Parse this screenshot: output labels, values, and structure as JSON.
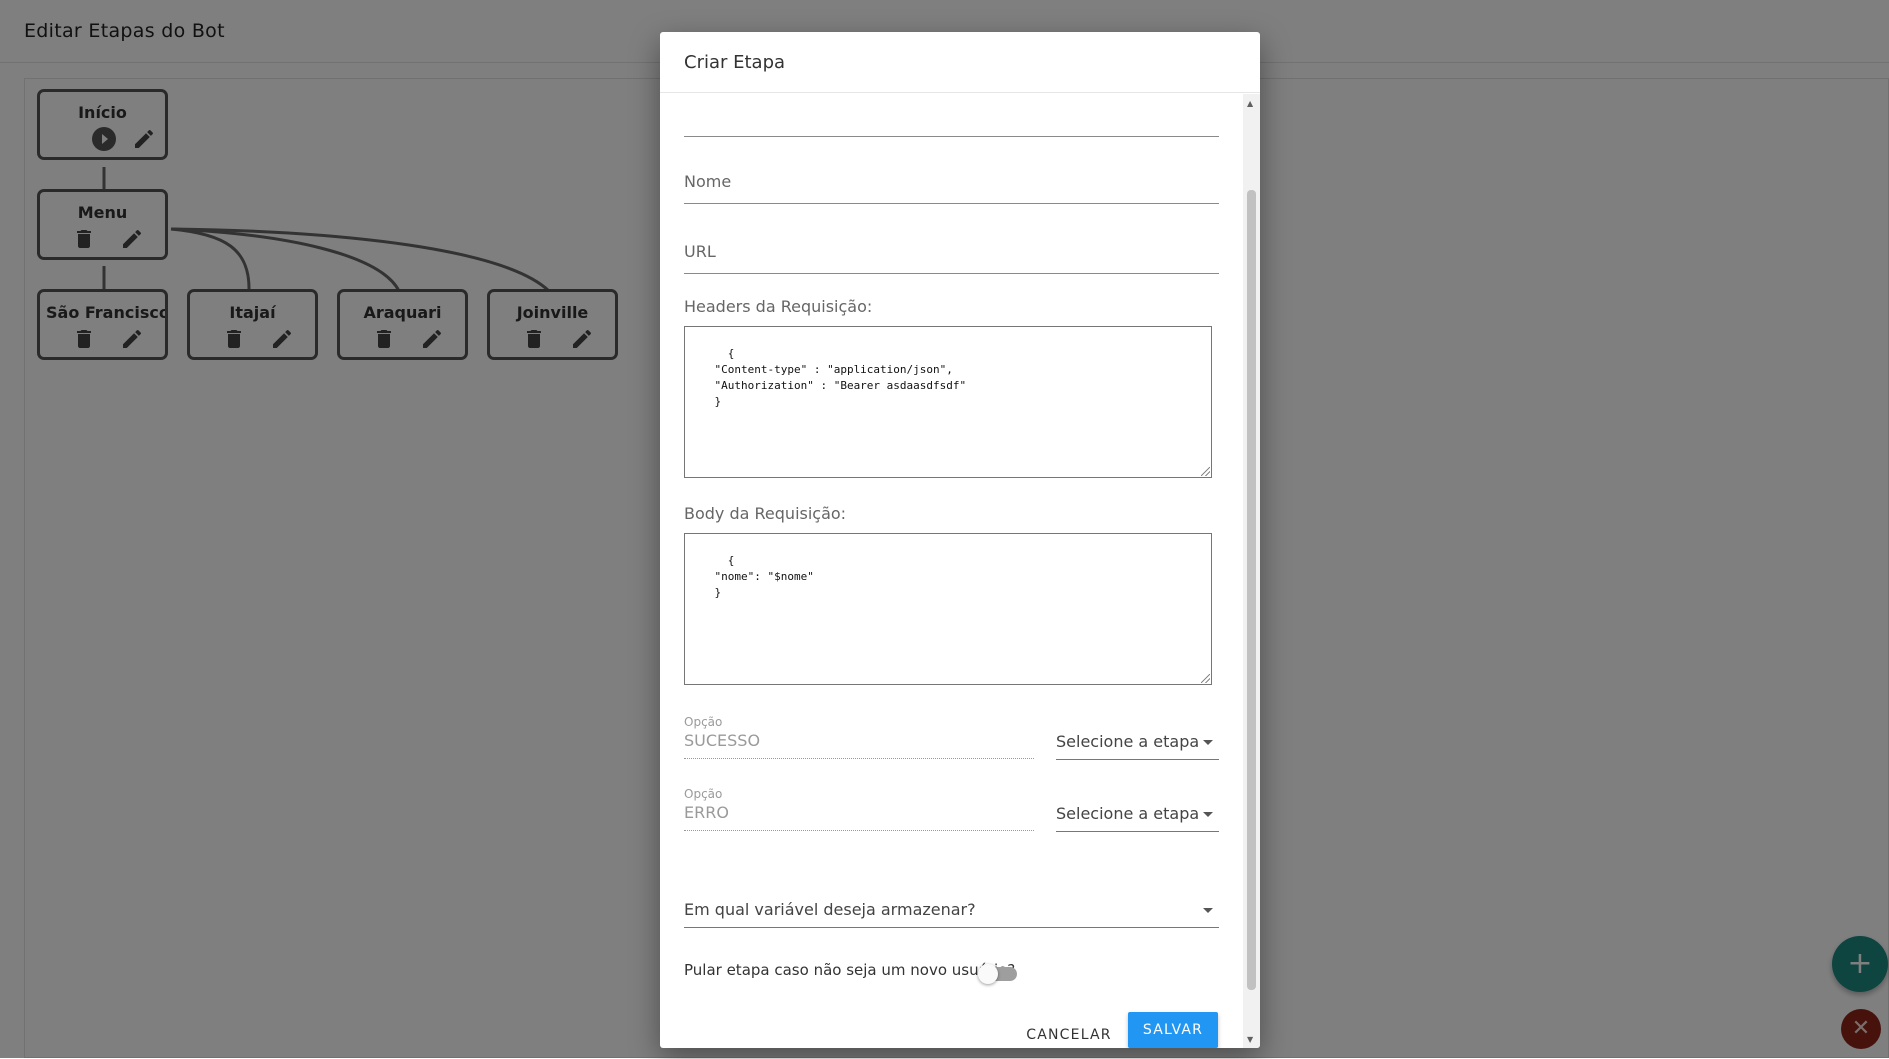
{
  "app": {
    "title": "Editar Etapas do Bot"
  },
  "colors": {
    "accent": "#2196f3",
    "fab_add": "#1d8a80",
    "fab_close": "#8f2419",
    "node_border": "#555555"
  },
  "flow": {
    "nodes": [
      {
        "label": "Início",
        "actions": [
          "play-icon",
          "pencil-icon"
        ]
      },
      {
        "label": "Menu",
        "actions": [
          "trash-icon",
          "pencil-icon"
        ]
      },
      {
        "label": "São Francisco do Sul",
        "actions": [
          "trash-icon",
          "pencil-icon"
        ]
      },
      {
        "label": "Itajaí",
        "actions": [
          "trash-icon",
          "pencil-icon"
        ]
      },
      {
        "label": "Araquari",
        "actions": [
          "trash-icon",
          "pencil-icon"
        ]
      },
      {
        "label": "Joinville",
        "actions": [
          "trash-icon",
          "pencil-icon"
        ]
      }
    ]
  },
  "fab": {
    "add_icon": "plus-icon",
    "close_icon": "close-icon",
    "add_label": "+",
    "close_label": "✕"
  },
  "dialog": {
    "title": "Criar Etapa",
    "fields": {
      "nome_placeholder": "Nome",
      "url_placeholder": "URL",
      "headers_label": "Headers da Requisição:",
      "headers_value": "{\n    \"Content-type\" : \"application/json\",\n    \"Authorization\" : \"Bearer asdaasdfsdf\"\n    }",
      "body_label": "Body da Requisição:",
      "body_value": "{\n    \"nome\": \"$nome\"\n    }"
    },
    "options": [
      {
        "small_label": "Opção",
        "value": "SUCESSO",
        "select_placeholder": "Selecione a etapa"
      },
      {
        "small_label": "Opção",
        "value": "ERRO",
        "select_placeholder": "Selecione a etapa"
      }
    ],
    "variable_select_placeholder": "Em qual variável deseja armazenar?",
    "skip_toggle_label": "Pular etapa caso não seja um novo usuário?",
    "skip_toggle_on": false,
    "cancel_label": "CANCELAR",
    "save_label": "SALVAR"
  }
}
